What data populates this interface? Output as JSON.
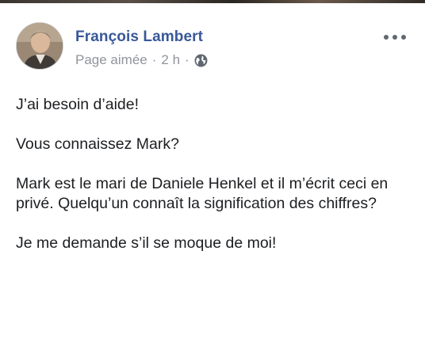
{
  "post": {
    "author": "François Lambert",
    "meta_page": "Page aimée",
    "meta_separator": "·",
    "meta_time": "2 h",
    "meta_separator2": "·",
    "audience_icon": "globe-icon",
    "more_icon": "more-options-icon",
    "paragraphs": [
      "J’ai besoin d’aide!",
      "Vous connaissez Mark?",
      "Mark est le mari de Daniele Henkel et il m’écrit ceci en privé. Quelqu’un connaît la signification des chiffres?",
      "Je me demande s’il se moque de moi!"
    ]
  },
  "colors": {
    "author": "#385898",
    "meta": "#90949c",
    "text": "#1c1e21",
    "icon": "#606770"
  }
}
